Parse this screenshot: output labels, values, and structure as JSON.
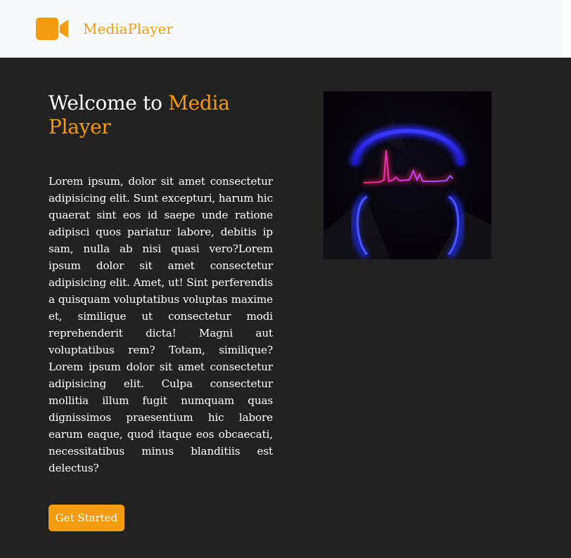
{
  "navbar": {
    "brand": "MediaPlayer",
    "brand_icon": "video-camera-icon"
  },
  "hero": {
    "title_prefix": "Welcome to ",
    "title_accent": "Media Player",
    "body": "Lorem ipsum, dolor sit amet consectetur adipisicing elit. Sunt excepturi, harum hic quaerat sint eos id saepe unde ratione adipisci quos pariatur labore, debitis ip sam, nulla ab nisi quasi vero?Lorem ipsum dolor sit amet consectetur adipisicing elit. Amet, ut! Sint perferendis a quisquam voluptatibus voluptas maxime et, similique ut consectetur modi reprehenderit dicta! Magni aut voluptatibus rem? Totam, similique?Lorem ipsum dolor sit amet consectetur adipisicing elit. Culpa consectetur mollitia illum fugit numquam quas dignissimos praesentium hic labore earum eaque, quod itaque eos obcaecati, necessitatibus minus blanditiis est delectus?",
    "cta_label": "Get Started",
    "image": "headphones-waveform-image"
  },
  "colors": {
    "accent": "#f39c12",
    "background": "#222222",
    "navbar": "#f7f9fb"
  }
}
